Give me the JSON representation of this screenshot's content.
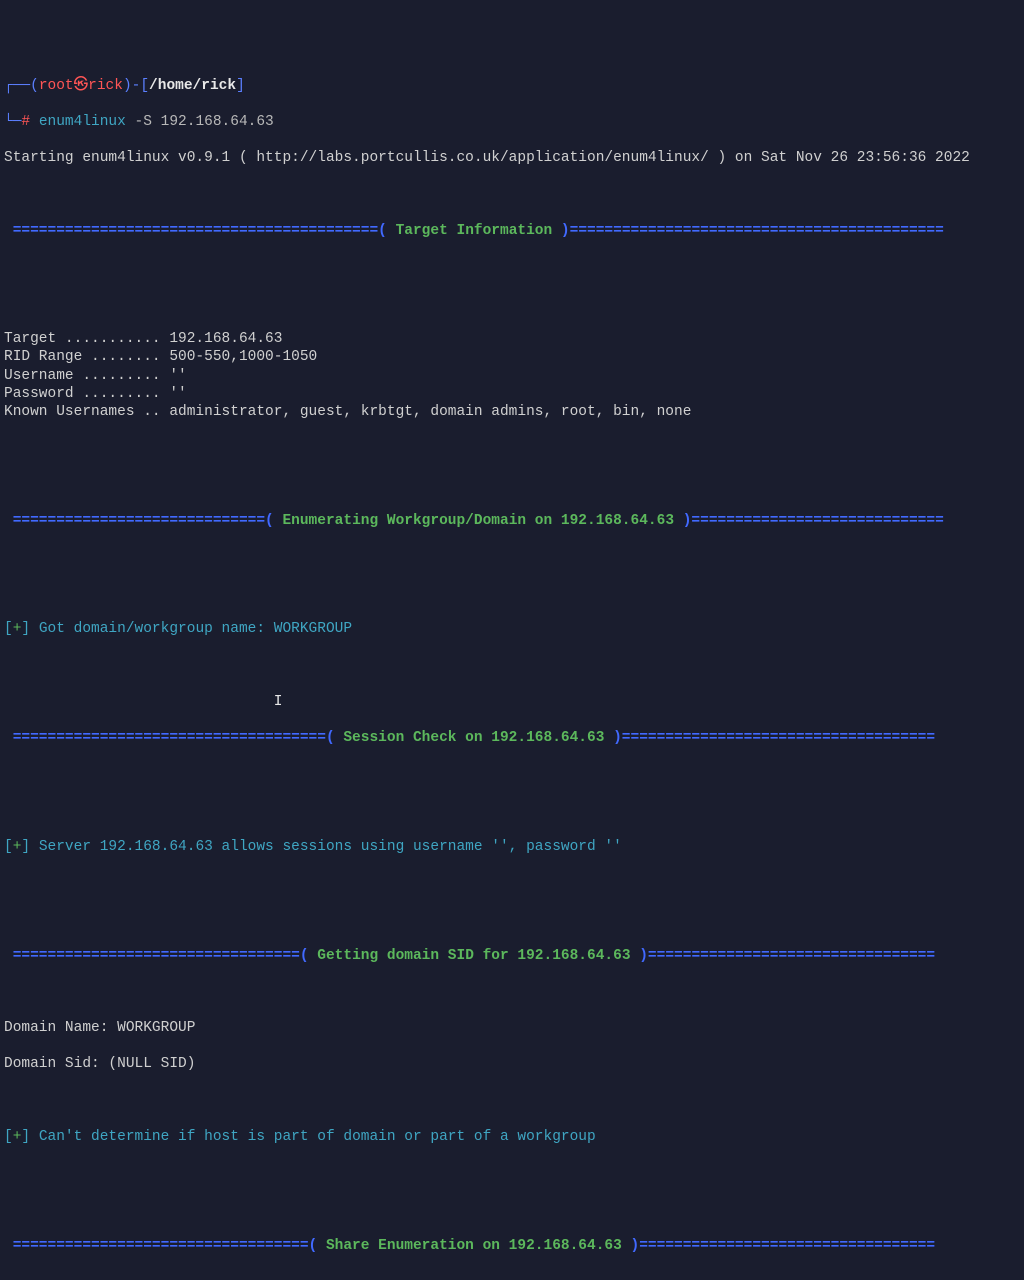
{
  "prompt": {
    "box_open": "┌──(",
    "user": "root",
    "skull": "㉿",
    "host": "rick",
    "box_close": ")-[",
    "cwd": "/home/rick",
    "box_end": "]",
    "line2_prefix": "└─",
    "hash": "# ",
    "cmd": "enum4linux",
    "args": " -S 192.168.64.63"
  },
  "starting": "Starting enum4linux v0.9.1 ( http://labs.portcullis.co.uk/application/enum4linux/ ) on Sat Nov 26 23:56:36 2022",
  "sections": {
    "target_info": {
      "title": "Target Information",
      "left": " ==========================================( ",
      "right": " )==========================================="
    },
    "enum_wg": {
      "title": "Enumerating Workgroup/Domain on 192.168.64.63",
      "left": " =============================( ",
      "right": " )============================="
    },
    "session": {
      "title": "Session Check on 192.168.64.63",
      "left": " ====================================( ",
      "right": " )===================================="
    },
    "sid": {
      "title": "Getting domain SID for 192.168.64.63",
      "left": " =================================( ",
      "right": " )================================="
    },
    "share": {
      "title": "Share Enumeration on 192.168.64.63",
      "left": " ==================================( ",
      "right": " )=================================="
    }
  },
  "target_block": "Target ........... 192.168.64.63\nRID Range ........ 500-550,1000-1050\nUsername ......... ''\nPassword ......... ''\nKnown Usernames .. administrator, guest, krbtgt, domain admins, root, bin, none",
  "lines": {
    "got_domain": "Got domain/workgroup name: WORKGROUP",
    "session_ok": "Server 192.168.64.63 allows sessions using username '', password ''",
    "domain_name": "Domain Name: WORKGROUP",
    "domain_sid": "Domain Sid: (NULL SID)",
    "cant_determine": "Can't determine if host is part of domain or part of a workgroup"
  },
  "markers": {
    "plus_open": "[",
    "plus": "+",
    "plus_close": "] "
  },
  "cursor": "I"
}
